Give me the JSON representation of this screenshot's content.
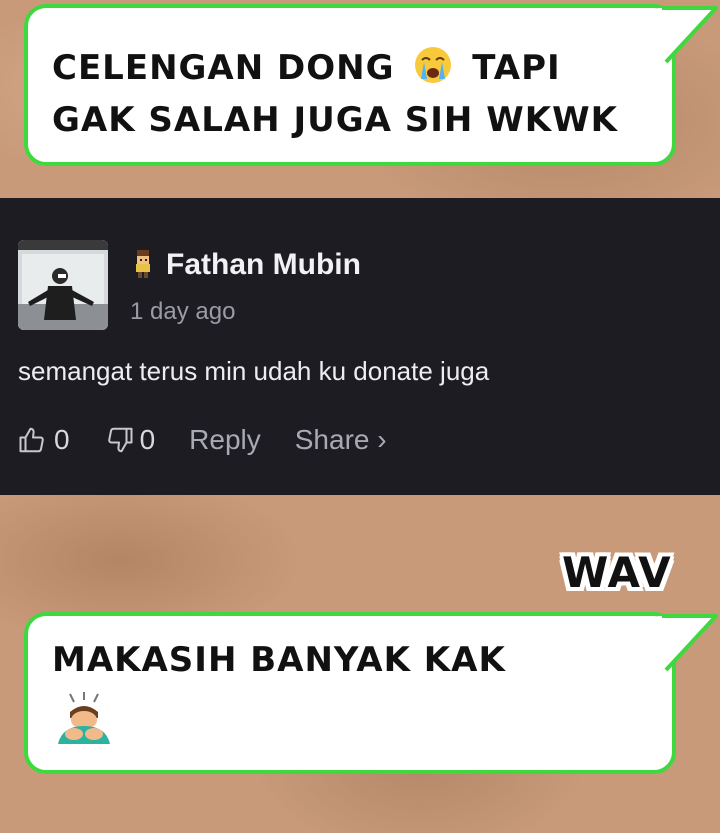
{
  "bubble_top": {
    "line1": "CELENGAN DONG",
    "emoji": "loudly-crying-face-icon",
    "line1_tail": "TAPI",
    "line2": "GAK SALAH JUGA SIH WKWK"
  },
  "comment": {
    "author_badge_icon": "pixel-character-icon",
    "author": "Fathan Mubin",
    "timestamp": "1 day ago",
    "text": "semangat terus min udah ku donate juga",
    "like_count": "0",
    "dislike_count": "0",
    "reply_label": "Reply",
    "share_label": "Share ›"
  },
  "sticker": {
    "label": "WAV"
  },
  "bubble_bottom": {
    "line1": "MAKASIH BANYAK KAK",
    "emoji": "person-bowing-icon"
  },
  "colors": {
    "bubble_border": "#3fd93f",
    "card_background": "#1c1c22",
    "background": "#c89a7a"
  }
}
